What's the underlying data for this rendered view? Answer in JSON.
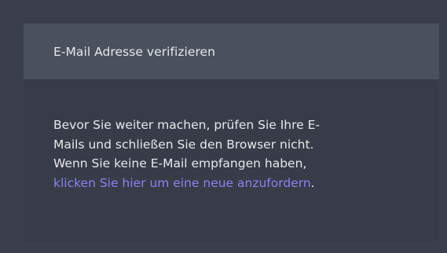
{
  "card": {
    "title": "E-Mail Adresse verifizieren",
    "body_line1": "Bevor Sie weiter machen, prüfen Sie Ihre E-",
    "body_line2": "Mails und schließen Sie den Browser nicht.",
    "body_line3": "Wenn Sie keine E-Mail empfangen haben,",
    "link_text": "klicken Sie hier um eine neue anzufordern",
    "link_suffix": "."
  },
  "colors": {
    "page_background": "#3a3f4b",
    "card_background": "#373c48",
    "header_background": "#4a505c",
    "text": "#e6e8ec",
    "link": "#8b82f0"
  }
}
